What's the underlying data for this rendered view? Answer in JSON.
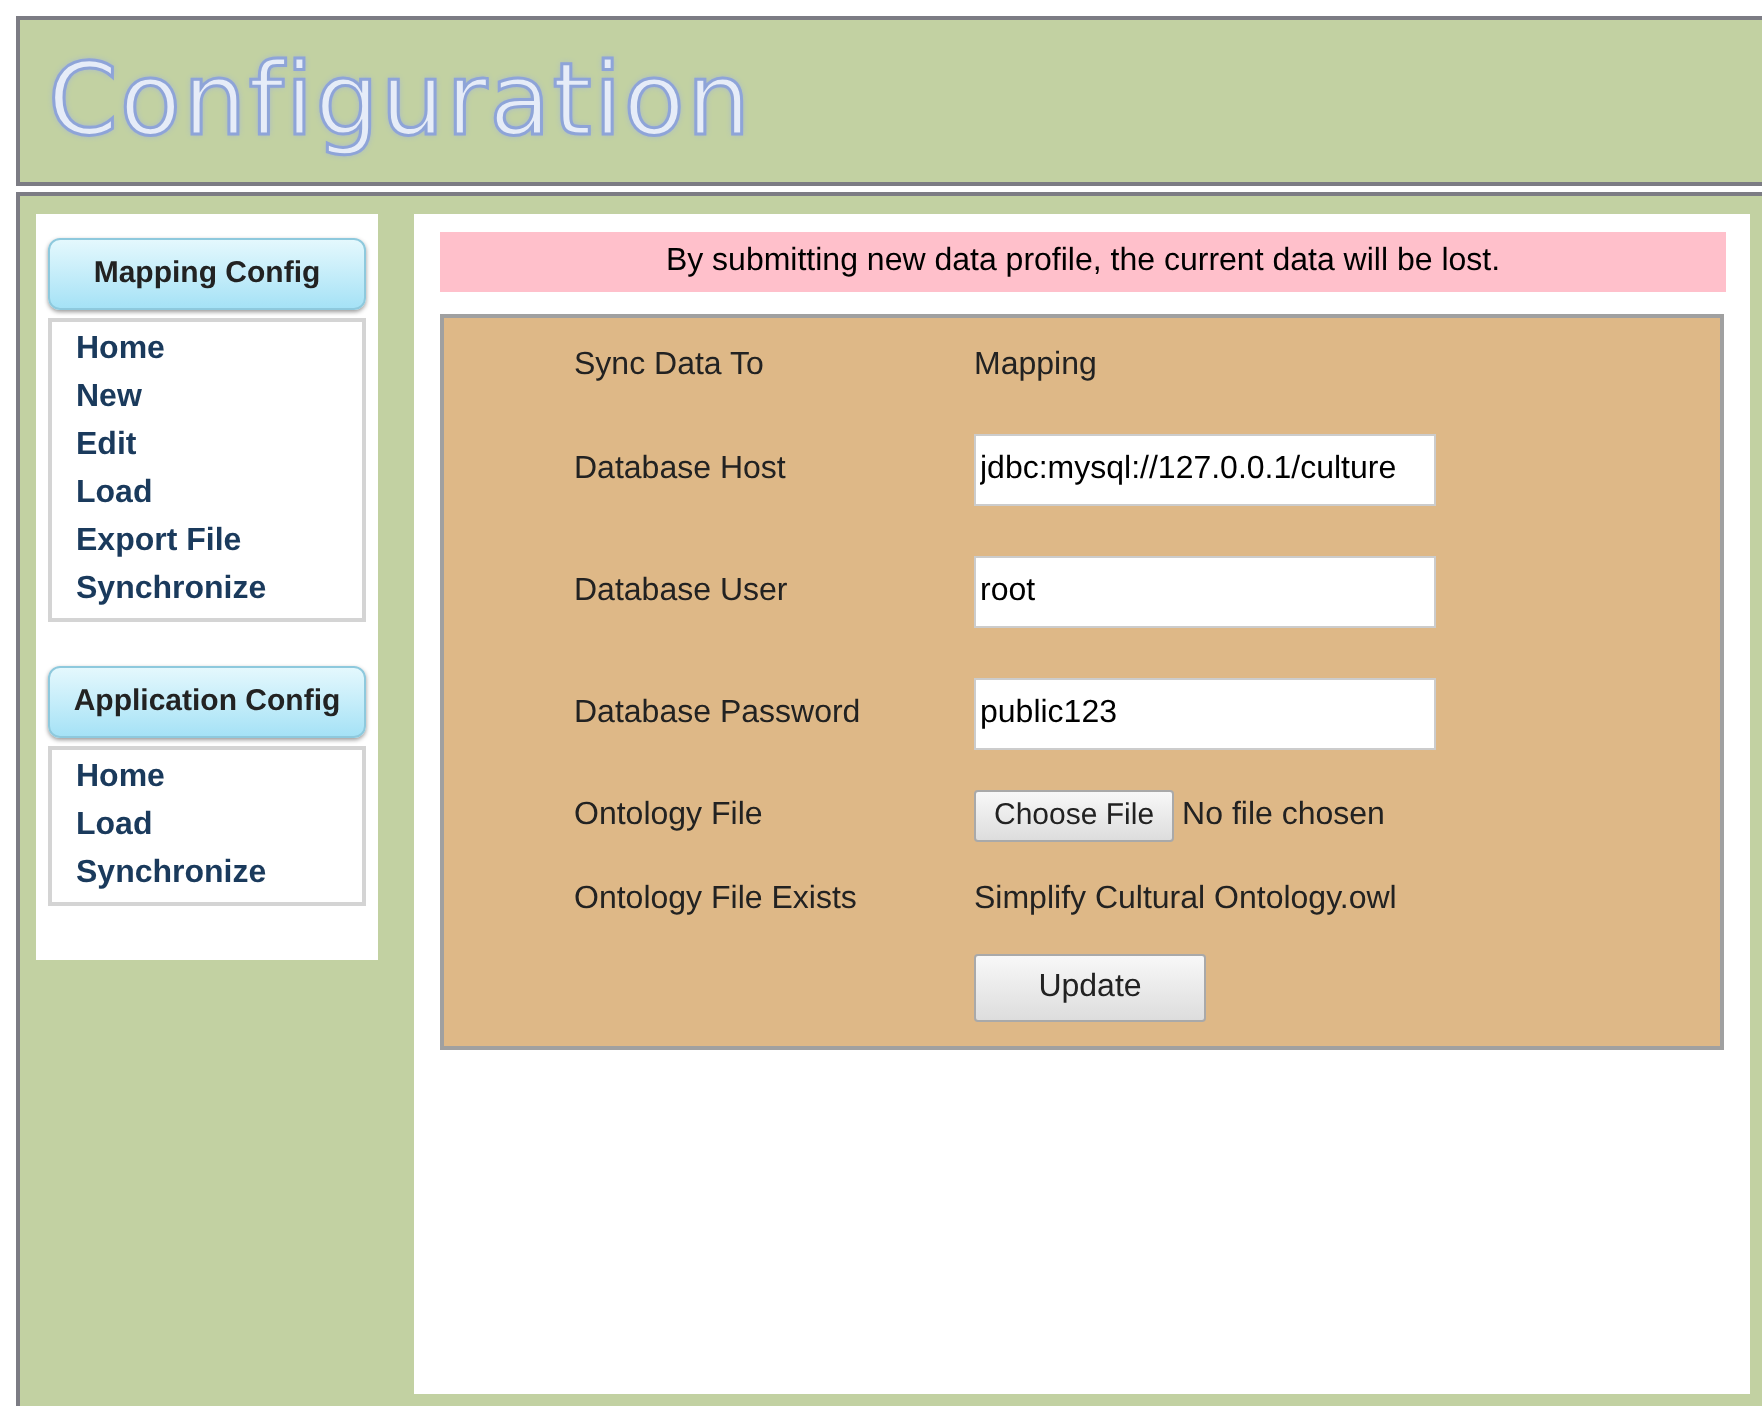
{
  "header": {
    "title": "Configuration"
  },
  "sidebar": [
    {
      "heading": "Mapping Config",
      "items": [
        "Home",
        "New",
        "Edit",
        "Load",
        "Export File",
        "Synchronize"
      ]
    },
    {
      "heading": "Application Config",
      "items": [
        "Home",
        "Load",
        "Synchronize"
      ]
    }
  ],
  "warning": "By submitting new data profile, the current data will be lost.",
  "form": [
    {
      "kind": "text",
      "label": "Sync Data To",
      "value": "Mapping"
    },
    {
      "kind": "input",
      "label": "Database Host",
      "value": "jdbc:mysql://127.0.0.1/culture"
    },
    {
      "kind": "input",
      "label": "Database User",
      "value": "root"
    },
    {
      "kind": "input",
      "label": "Database Password",
      "value": "public123"
    },
    {
      "kind": "file",
      "label": "Ontology File",
      "button": "Choose File",
      "status": "No file chosen"
    },
    {
      "kind": "text",
      "label": "Ontology File Exists",
      "value": "Simplify Cultural Ontology.owl"
    }
  ],
  "submit": "Update"
}
